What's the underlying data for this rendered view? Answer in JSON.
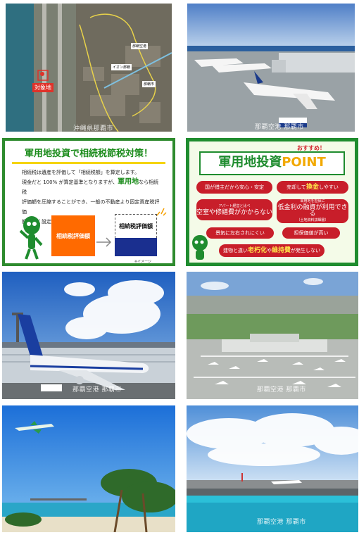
{
  "tiles": {
    "map": {
      "label_site": "対象地",
      "label_a": "那覇空港",
      "label_b": "イオン那覇",
      "label_c": "那覇市",
      "watermark": "沖縄県那覇市"
    },
    "airport_apron": {
      "watermark": "那覇空港 那覇市"
    },
    "tax_card": {
      "heading": "軍用地投資で相続税節税対策！",
      "line1": "相続税は遺産を評価して「相続税額」を算定します。",
      "line2_a": "現金だと 100% が算定基準となりますが、",
      "line2_hl": "軍用地",
      "line2_b": "なら相続税",
      "line3": "評価額を圧縮することができ、一般の不動産より固定資産税評価",
      "line4": "額も低く設定されています。",
      "bar_left_label": "相続税評価額",
      "bar_right_label": "相続税評価額",
      "note": "※イメージ"
    },
    "point_card": {
      "recommend": "おすすめ！",
      "title_a": "軍用地投資",
      "title_b": "POINT",
      "p1": "国が借主だから安心・安定",
      "p2_a": "売却して",
      "p2_hl": "換金",
      "p2_b": "しやすい",
      "p3_a": "アパート経営と比べ",
      "p3_b": "空室や修繕費がかからない",
      "p4_a": "軍用地を担保に",
      "p4_b": "低金利の融資が利用できる",
      "p4_c": "（土地資料詳細書）",
      "p5": "景気に左右されにくい",
      "p6": "担保価値が高い",
      "p7_a": "建物と違い",
      "p7_hl": "老朽化",
      "p7_b": "や",
      "p7_hl2": "維持費",
      "p7_c": "が発生しない"
    },
    "plane_terminal": {
      "watermark": "那覇空港 那覇市"
    },
    "aerial_airport": {
      "watermark": "那覇空港 那覇市"
    },
    "beach_plane": {},
    "sea_runway": {
      "watermark": "那覇空港 那覇市"
    }
  },
  "colors": {
    "green": "#1f8c2f",
    "red": "#c81e2a",
    "orange": "#ff6a00",
    "navy": "#1a2f8f",
    "yellow": "#f5d400"
  }
}
